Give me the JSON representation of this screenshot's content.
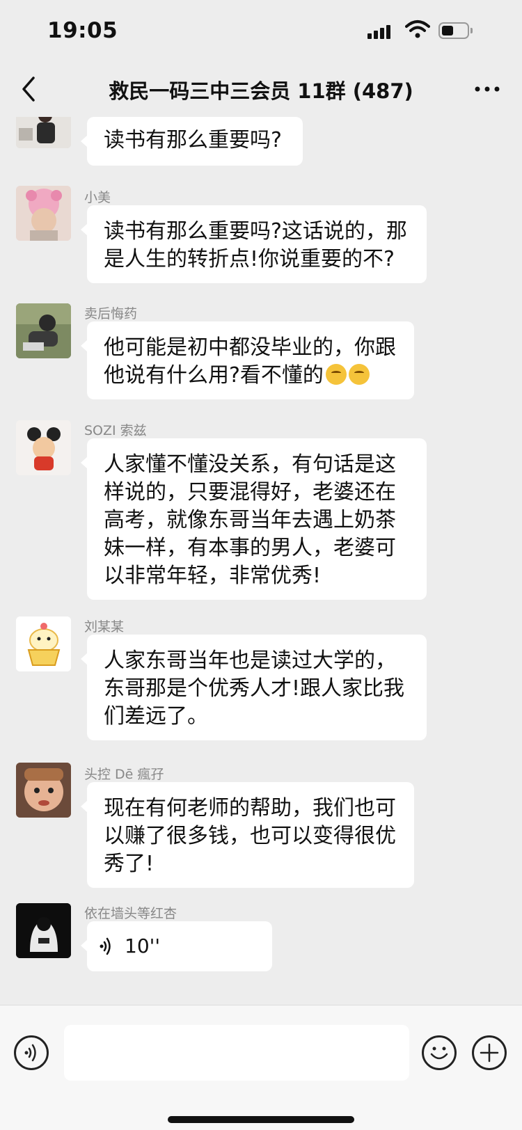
{
  "status": {
    "time": "19:05"
  },
  "header": {
    "title": "救民一码三中三会员 11群 (487)"
  },
  "messages": [
    {
      "sender": "",
      "lines": [
        "读书有那么重要吗?"
      ]
    },
    {
      "sender": "小美",
      "lines": [
        "读书有那么重要吗?这话说的，那",
        "是人生的转折点!你说重要的不?"
      ]
    },
    {
      "sender": "卖后悔药",
      "lines": [
        "他可能是初中都没毕业的，你跟",
        "他说有什么用?看不懂的"
      ],
      "trailing_emoji": "thinking-face-icon x2"
    },
    {
      "sender": "SOZI 索兹",
      "lines": [
        "人家懂不懂没关系，有句话是这",
        "样说的，只要混得好，老婆还在",
        "高考，就像东哥当年去遇上奶茶",
        "妹一样，有本事的男人，老婆可",
        "以非常年轻，非常优秀!"
      ]
    },
    {
      "sender": "刘某某",
      "lines": [
        "人家东哥当年也是读过大学的，",
        "东哥那是个优秀人才!跟人家比我",
        "们差远了。"
      ]
    },
    {
      "sender": "头控 Dē 瘋孖",
      "lines": [
        "现在有何老师的帮助，我们也可",
        "以赚了很多钱，也可以变得很优",
        "秀了!"
      ]
    },
    {
      "sender": "依在墙头等红杏",
      "voice_duration": "10''"
    }
  ],
  "input": {
    "placeholder": ""
  },
  "colors": {
    "background": "#ededed",
    "bubble": "#ffffff",
    "sender_text": "#888888",
    "input_bar": "#f7f7f7"
  }
}
